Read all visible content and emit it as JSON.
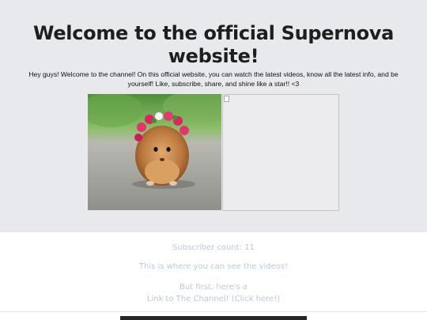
{
  "header": {
    "title": "Welcome to the official Supernova website!",
    "intro": "Hey guys! Welcome to the channel! On this official website, you can watch the latest videos, know all the latest info, and be yourself! Like, subscribe, share, and shine like a star!! <3"
  },
  "images": {
    "photo_alt": "guinea pig wearing a flower crown",
    "broken_icon": "broken-image-icon"
  },
  "info": {
    "subscriber_count": "Subscriber count: 11",
    "videos_text": "This is where you can see the videos!",
    "first_text": "But first, here's a",
    "channel_link": "Link to The Channel! (Click here!)"
  },
  "colors": {
    "hero_bg": "#e8e9ed",
    "title_text": "#1e1e1e",
    "pale_text": "#bcc9d9"
  }
}
